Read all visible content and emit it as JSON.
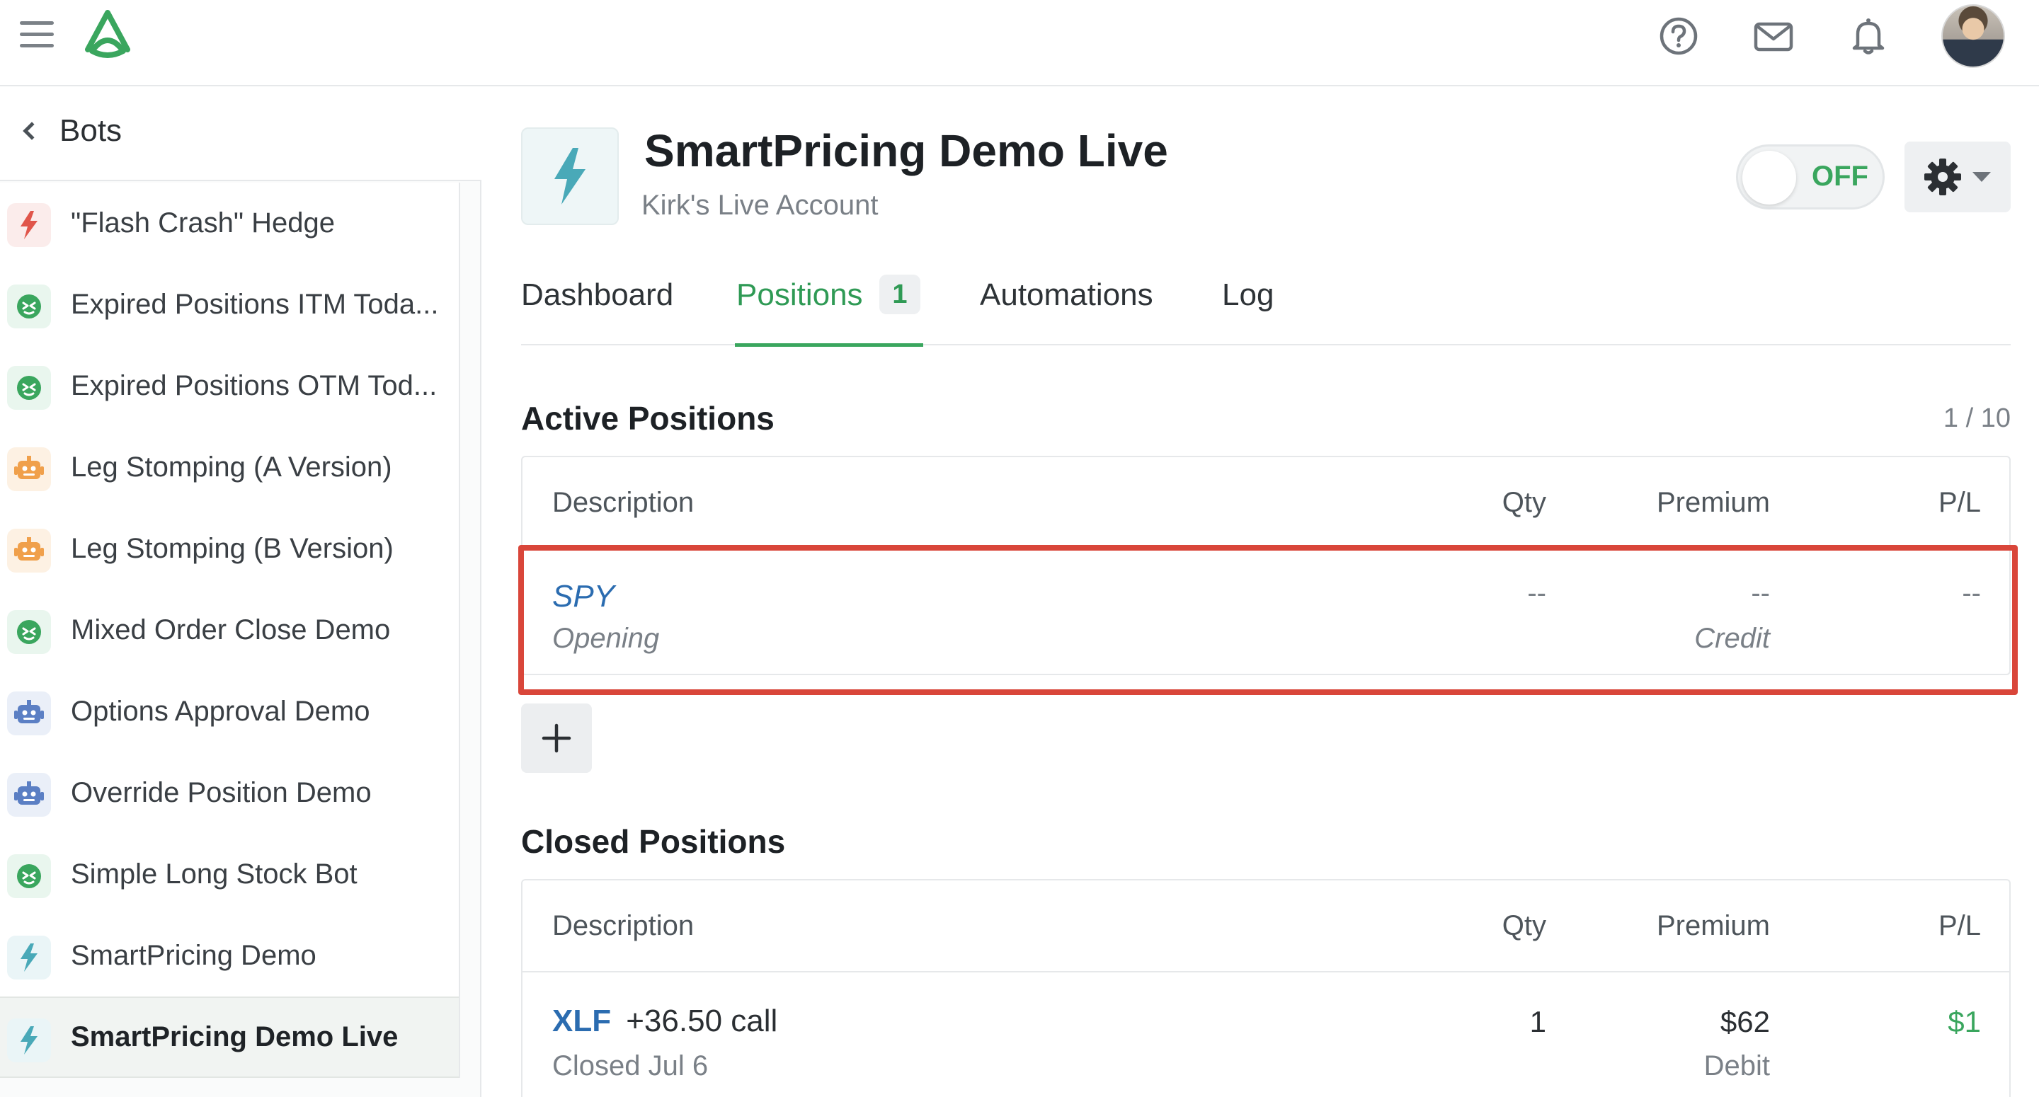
{
  "topbar": {
    "icons": [
      "hamburger-icon",
      "logo-icon",
      "help-icon",
      "mail-icon",
      "bell-icon",
      "avatar"
    ]
  },
  "sidebar": {
    "back_label": "Bots",
    "bots": [
      {
        "label": "\"Flash Crash\" Hedge",
        "icon": "lightning-icon",
        "color": "#e0554a",
        "bg": "#fbeceb"
      },
      {
        "label": "Expired Positions ITM Toda...",
        "icon": "robot-face-icon",
        "color": "#3aa65e",
        "bg": "#e9f6ee"
      },
      {
        "label": "Expired Positions OTM Tod...",
        "icon": "robot-face-icon",
        "color": "#3aa65e",
        "bg": "#e9f6ee"
      },
      {
        "label": "Leg Stomping (A Version)",
        "icon": "robot-icon",
        "color": "#f0a04b",
        "bg": "#fdf1e3"
      },
      {
        "label": "Leg Stomping (B Version)",
        "icon": "robot-icon",
        "color": "#f0a04b",
        "bg": "#fdf1e3"
      },
      {
        "label": "Mixed Order Close Demo",
        "icon": "robot-face-icon",
        "color": "#3aa65e",
        "bg": "#e9f6ee"
      },
      {
        "label": "Options Approval Demo",
        "icon": "robot-icon",
        "color": "#5b7fc4",
        "bg": "#eaeff8"
      },
      {
        "label": "Override Position Demo",
        "icon": "robot-icon",
        "color": "#5b7fc4",
        "bg": "#eaeff8"
      },
      {
        "label": "Simple Long Stock Bot",
        "icon": "robot-face-icon",
        "color": "#3aa65e",
        "bg": "#e9f6ee"
      },
      {
        "label": "SmartPricing Demo",
        "icon": "lightning-icon",
        "color": "#49a9b8",
        "bg": "#eaf5f7"
      },
      {
        "label": "SmartPricing Demo Live",
        "icon": "lightning-icon",
        "color": "#49a9b8",
        "bg": "#eaf5f7",
        "active": true
      }
    ]
  },
  "header": {
    "title": "SmartPricing Demo Live",
    "subtitle": "Kirk's Live Account",
    "toggle_label": "OFF",
    "accent": "#3aa65e"
  },
  "tabs": {
    "dashboard": "Dashboard",
    "positions": "Positions",
    "positions_badge": "1",
    "automations": "Automations",
    "log": "Log"
  },
  "active_positions": {
    "title": "Active Positions",
    "count": "1 / 10",
    "columns": {
      "description": "Description",
      "qty": "Qty",
      "premium": "Premium",
      "pl": "P/L"
    },
    "rows": [
      {
        "symbol": "SPY",
        "status": "Opening",
        "qty": "--",
        "premium": "--",
        "premium_type": "Credit",
        "pl": "--"
      }
    ]
  },
  "closed_positions": {
    "title": "Closed Positions",
    "columns": {
      "description": "Description",
      "qty": "Qty",
      "premium": "Premium",
      "pl": "P/L"
    },
    "rows": [
      {
        "symbol": "XLF",
        "detail": "+36.50 call",
        "status": "Closed Jul 6",
        "qty": "1",
        "premium": "$62",
        "premium_type": "Debit",
        "pl": "$1"
      }
    ]
  }
}
